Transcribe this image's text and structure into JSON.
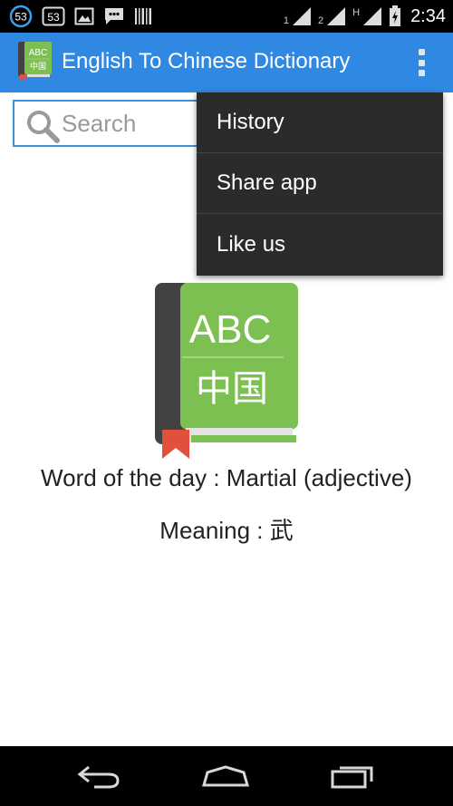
{
  "status_bar": {
    "notification_count": "53",
    "sim_tag_1": "1",
    "sim_tag_2": "2",
    "network_type": "H",
    "time": "2:34",
    "icons": [
      "notification-badge-icon",
      "outlined-badge-icon",
      "image-icon",
      "chat-icon",
      "barcode-icon",
      "signal-icon",
      "signal-icon",
      "battery-icon"
    ]
  },
  "app_bar": {
    "title": "English To Chinese Dictionary",
    "logo_text_top": "ABC",
    "logo_text_bottom": "中国"
  },
  "search": {
    "placeholder": "Search",
    "value": ""
  },
  "overflow_menu": {
    "items": [
      {
        "label": "History"
      },
      {
        "label": "Share app"
      },
      {
        "label": "Like us"
      }
    ]
  },
  "main": {
    "logo_text_top": "ABC",
    "logo_text_bottom": "中国",
    "word_of_the_day": "Word of the day : Martial (adjective)",
    "meaning": "Meaning : 武"
  },
  "colors": {
    "app_bar": "#2f89e2",
    "menu_bg": "#2b2b2b",
    "book_green": "#7cc052",
    "book_spine": "#424242",
    "bookmark": "#e1503b"
  }
}
